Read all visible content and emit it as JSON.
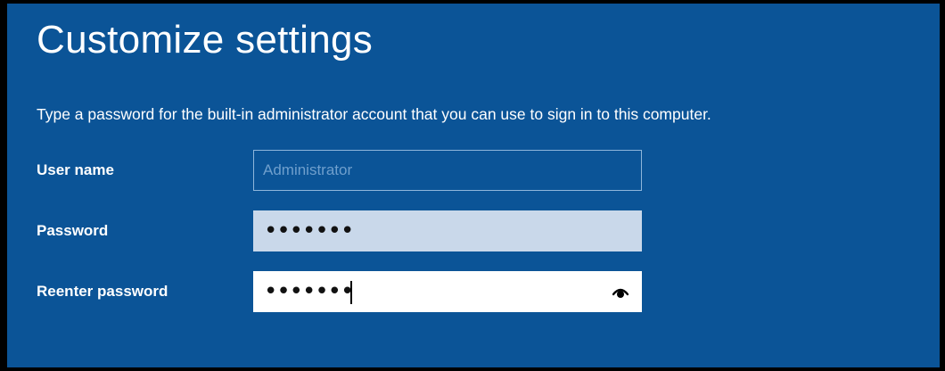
{
  "setup": {
    "title": "Customize settings",
    "instructions": "Type a password for the built-in administrator account that you can use to sign in to this computer."
  },
  "fields": {
    "username": {
      "label": "User name",
      "value": "Administrator"
    },
    "password": {
      "label": "Password",
      "masked": "•••••••"
    },
    "reenter": {
      "label": "Reenter password",
      "masked": "•••••••",
      "reveal_icon": "eye-icon"
    }
  },
  "colors": {
    "background": "#0b5497",
    "text": "#ffffff",
    "disabled_text": "#6f9fcd",
    "password_field_bg": "#c9d8ea",
    "active_field_bg": "#ffffff"
  }
}
